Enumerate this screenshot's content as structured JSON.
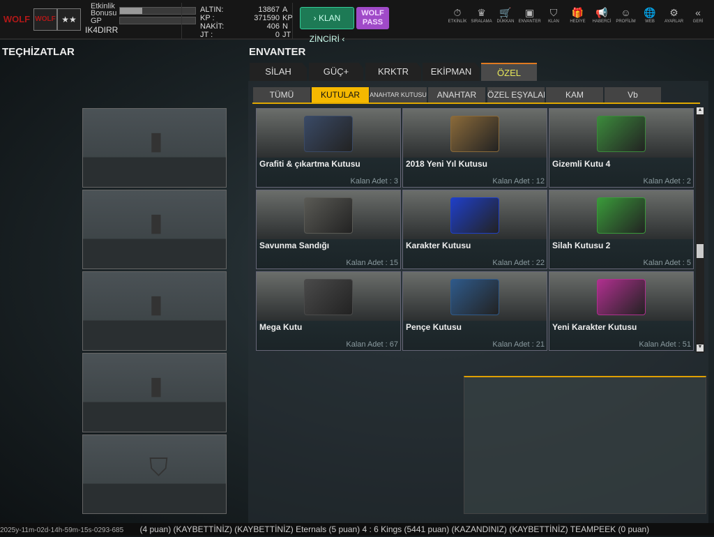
{
  "header": {
    "logo": "WOLF",
    "badge": "WOLF",
    "rank": "★★",
    "bonus_label": "Etkinlik Bonusu",
    "bonus_fill": 0.3,
    "gp_label": "GP",
    "gp_fill": 0,
    "username": "IK4DIRR",
    "stats": [
      {
        "label": "ALTIN:",
        "value": "13867",
        "unit": "A"
      },
      {
        "label": "KP :",
        "value": "371590",
        "unit": "KP"
      },
      {
        "label": "NAKİT:",
        "value": "406",
        "unit": "N"
      },
      {
        "label": "JT :",
        "value": "0",
        "unit": "JT"
      }
    ],
    "klan_button": "› KLAN ZİNCİRİ ‹",
    "wolf_pass": "WOLF PASS",
    "nav": [
      {
        "label": "ETKİNLİK",
        "icon": "⏱"
      },
      {
        "label": "SIRALAMA",
        "icon": "♛"
      },
      {
        "label": "DÜKKAN",
        "icon": "🛒"
      },
      {
        "label": "ENVANTER",
        "icon": "▣"
      },
      {
        "label": "KLAN",
        "icon": "⛉"
      },
      {
        "label": "HEDİYE",
        "icon": "🎁"
      },
      {
        "label": "HABERCİ",
        "icon": "📢"
      },
      {
        "label": "PROFİLİM",
        "icon": "☺"
      },
      {
        "label": "WEB",
        "icon": "🌐"
      },
      {
        "label": "AYARLAR",
        "icon": "⚙"
      },
      {
        "label": "GERİ",
        "icon": "«"
      }
    ]
  },
  "left": {
    "title": "TEÇHİZATLAR"
  },
  "inventory": {
    "title": "ENVANTER",
    "tabs": [
      "SİLAH",
      "GÜÇ+",
      "KRKTR",
      "EKİPMAN",
      "ÖZEL"
    ],
    "active_tab": "ÖZEL",
    "subtabs": [
      "TÜMÜ",
      "KUTULAR",
      "ANAHTAR KUTUSU",
      "ANAHTAR",
      "ÖZEL EŞYALAR",
      "KAM",
      "Vb"
    ],
    "active_subtab": "KUTULAR",
    "items": [
      {
        "name": "Grafiti & çıkartma Kutusu",
        "qty": "Kalan Adet : 3",
        "color": "#3a4a66"
      },
      {
        "name": "2018 Yeni Yıl Kutusu",
        "qty": "Kalan Adet : 12",
        "color": "#8a6a3a"
      },
      {
        "name": "Gizemli Kutu 4",
        "qty": "Kalan Adet : 2",
        "color": "#3c8a3c"
      },
      {
        "name": "Savunma Sandığı",
        "qty": "Kalan Adet : 15",
        "color": "#5a5a55"
      },
      {
        "name": "Karakter Kutusu",
        "qty": "Kalan Adet : 22",
        "color": "#1f3fc8"
      },
      {
        "name": "Silah Kutusu 2",
        "qty": "Kalan Adet : 5",
        "color": "#3a9a3a"
      },
      {
        "name": "Mega Kutu",
        "qty": "Kalan Adet : 67",
        "color": "#4a4a4a"
      },
      {
        "name": "Pençe Kutusu",
        "qty": "Kalan Adet : 21",
        "color": "#2f5a8a"
      },
      {
        "name": "Yeni Karakter Kutusu",
        "qty": "Kalan Adet : 51",
        "color": "#b0308f"
      }
    ]
  },
  "ticker": {
    "timestamp": "2025y-11m-02d-14h-59m-15s-0293-685",
    "text": "(4 puan) (KAYBETTİNİZ)    (KAYBETTİNİZ) Eternals (5 puan) 4 : 6 Kings (5441 puan) (KAZANDINIZ)            (KAYBETTİNİZ) TEAMPEEK (0 puan)"
  }
}
